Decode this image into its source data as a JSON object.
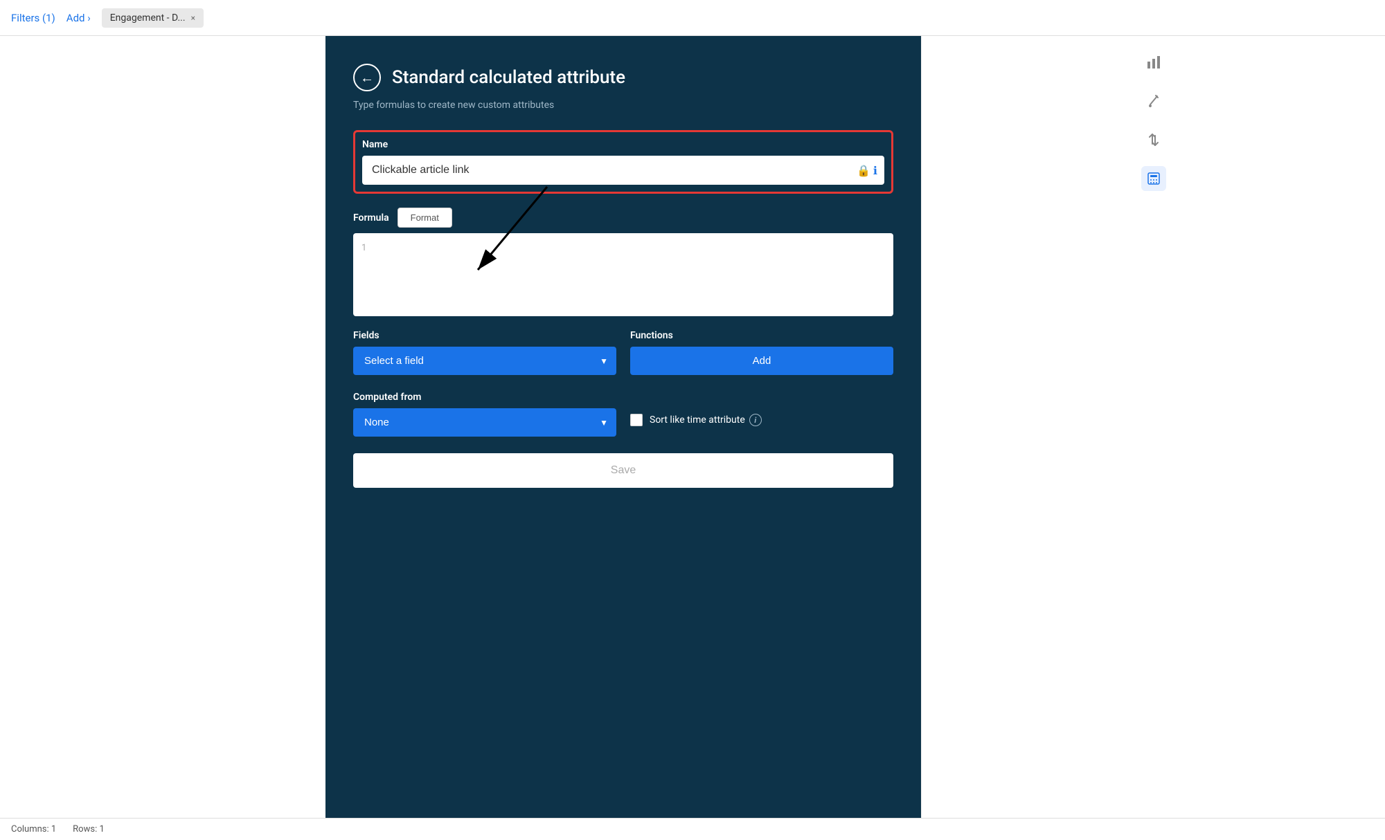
{
  "topbar": {
    "filters_label": "Filters (1)",
    "add_label": "Add ›",
    "tab_label": "Engagement - D...",
    "tab_close": "×"
  },
  "panel": {
    "title": "Standard calculated attribute",
    "subtitle": "Type formulas to create new custom attributes",
    "back_icon": "←",
    "name_label": "Name",
    "name_value": "Clickable article link",
    "name_placeholder": "Clickable article link",
    "formula_label": "Formula",
    "tab_format_label": "Format",
    "tab_formula_label": "",
    "line_number": "1",
    "fields_label": "Fields",
    "fields_placeholder": "Select a field",
    "functions_label": "Functions",
    "add_btn_label": "Add",
    "computed_label": "Computed from",
    "computed_placeholder": "None",
    "sort_label": "Sort like time attribute",
    "save_label": "Save"
  },
  "sidebar": {
    "icon1": "📊",
    "icon2": "✏️",
    "icon3": "⇅",
    "icon4": "🖩"
  },
  "statusbar": {
    "columns": "Columns: 1",
    "rows": "Rows: 1"
  },
  "colors": {
    "accent": "#1a73e8",
    "panel_bg": "#0d3349",
    "error_border": "#e53935"
  }
}
